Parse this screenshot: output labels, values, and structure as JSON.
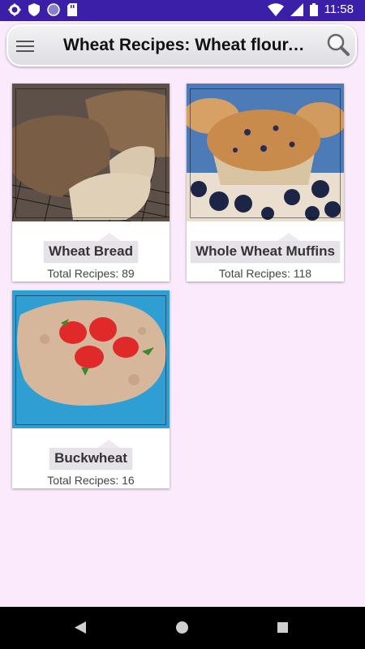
{
  "status_bar": {
    "time": "11:58",
    "left_icons": [
      "gear-icon",
      "shield-icon",
      "circle-icon",
      "sd-card-icon"
    ],
    "right_icons": [
      "wifi-icon",
      "signal-icon",
      "battery-icon"
    ]
  },
  "toolbar": {
    "title": "Wheat Recipes: Wheat flour, Whole wheat, Buckwheat"
  },
  "categories": [
    {
      "name": "Wheat Bread",
      "count_text": "Total Recipes: 89"
    },
    {
      "name": "Whole Wheat Muffins",
      "count_text": "Total Recipes: 118"
    },
    {
      "name": "Buckwheat",
      "count_text": "Total Recipes: 16"
    }
  ],
  "colors": {
    "status_bar": "#3b1fa8",
    "background": "#faeafc",
    "label_bg": "#e7e1ea",
    "nav_bar": "#000000"
  }
}
